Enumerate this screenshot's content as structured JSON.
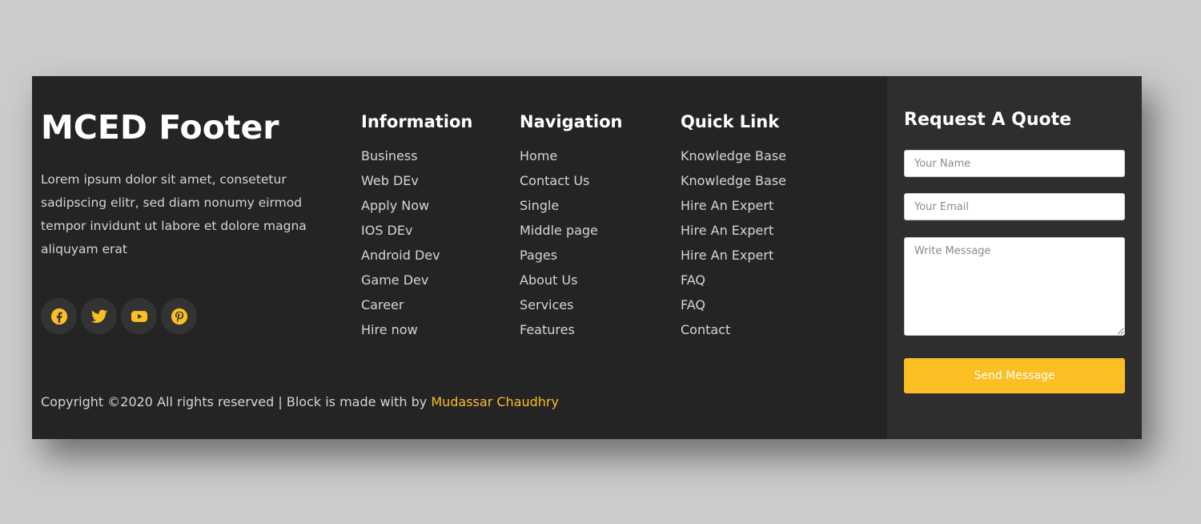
{
  "brand": {
    "title": "MCED Footer",
    "description": "Lorem ipsum dolor sit amet, consetetur sadipscing elitr, sed diam nonumy eirmod tempor invidunt ut labore et dolore magna aliquyam erat"
  },
  "social": [
    {
      "icon": "facebook-icon"
    },
    {
      "icon": "twitter-icon"
    },
    {
      "icon": "youtube-icon"
    },
    {
      "icon": "pinterest-icon"
    }
  ],
  "columns": {
    "information": {
      "title": "Information",
      "items": [
        "Business",
        "Web DEv",
        "Apply Now",
        "IOS DEv",
        "Android Dev",
        "Game Dev",
        "Career",
        "Hire now"
      ]
    },
    "navigation": {
      "title": "Navigation",
      "items": [
        "Home",
        "Contact Us",
        "Single",
        "Middle page",
        "Pages",
        "About Us",
        "Services",
        "Features"
      ]
    },
    "quick_link": {
      "title": "Quick Link",
      "items": [
        "Knowledge Base",
        "Knowledge Base",
        "Hire An Expert",
        "Hire An Expert",
        "Hire An Expert",
        "FAQ",
        "FAQ",
        "Contact"
      ]
    }
  },
  "copyright": {
    "text": "Copyright ©2020 All rights reserved | Block is made with by ",
    "author": "Mudassar Chaudhry"
  },
  "quote_form": {
    "title": "Request A Quote",
    "name_placeholder": "Your Name",
    "email_placeholder": "Your Email",
    "message_placeholder": "Write Message",
    "submit_label": "Send Message"
  },
  "colors": {
    "background": "#cbcbcb",
    "footer": "#242424",
    "panel": "#2e2e2e",
    "accent": "#fbbf24",
    "social_circle": "#333333"
  }
}
